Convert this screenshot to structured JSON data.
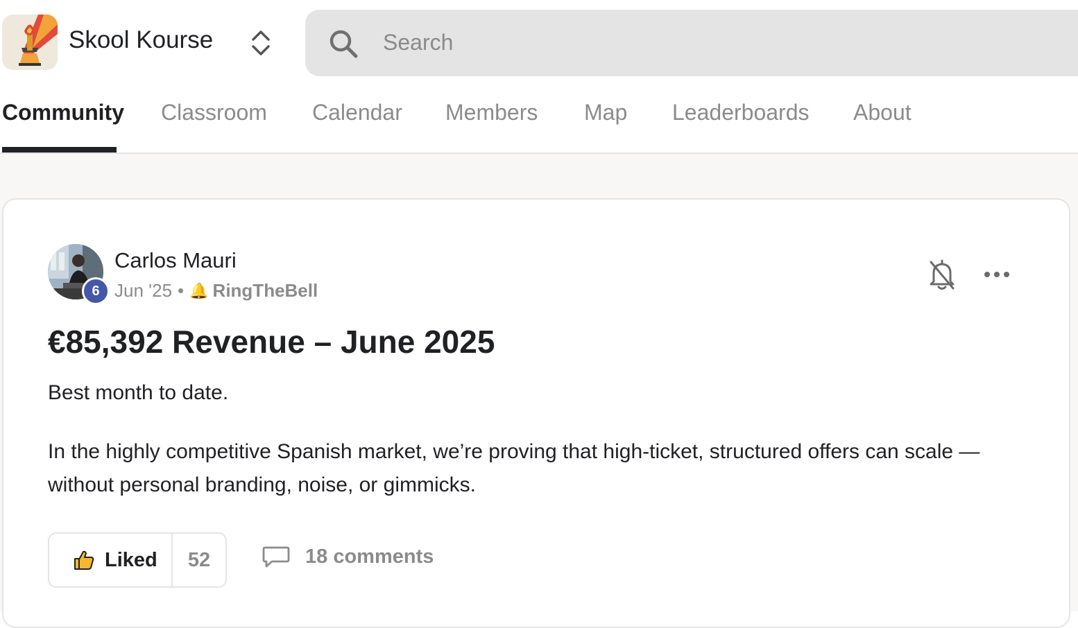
{
  "header": {
    "community_name": "Skool Kourse",
    "logo_icon": "torch-logo-icon",
    "switcher_icon": "chevron-up-down-icon",
    "search": {
      "placeholder": "Search",
      "value": "",
      "icon": "search-icon"
    }
  },
  "nav": {
    "tabs": [
      {
        "label": "Community",
        "active": true
      },
      {
        "label": "Classroom",
        "active": false
      },
      {
        "label": "Calendar",
        "active": false
      },
      {
        "label": "Members",
        "active": false
      },
      {
        "label": "Map",
        "active": false
      },
      {
        "label": "Leaderboards",
        "active": false
      },
      {
        "label": "About",
        "active": false
      }
    ]
  },
  "post": {
    "author": "Carlos Mauri",
    "level": "6",
    "date": "Jun '25",
    "separator": "•",
    "category_emoji": "🔔",
    "category": "RingTheBell",
    "title": "€85,392 Revenue – June 2025",
    "paragraphs": [
      "Best month to date.",
      "In the highly competitive Spanish market, we’re proving that high-ticket, structured offers can scale — without personal branding, noise, or gimmicks."
    ],
    "actions": {
      "like_label": "Liked",
      "like_count": "52",
      "comments_label": "18 comments"
    }
  },
  "colors": {
    "text_primary": "#202124",
    "text_muted": "#8b8b8b",
    "search_bg": "#e4e4e4",
    "level_badge": "#4457a8",
    "page_bg": "#f8f7f5"
  }
}
